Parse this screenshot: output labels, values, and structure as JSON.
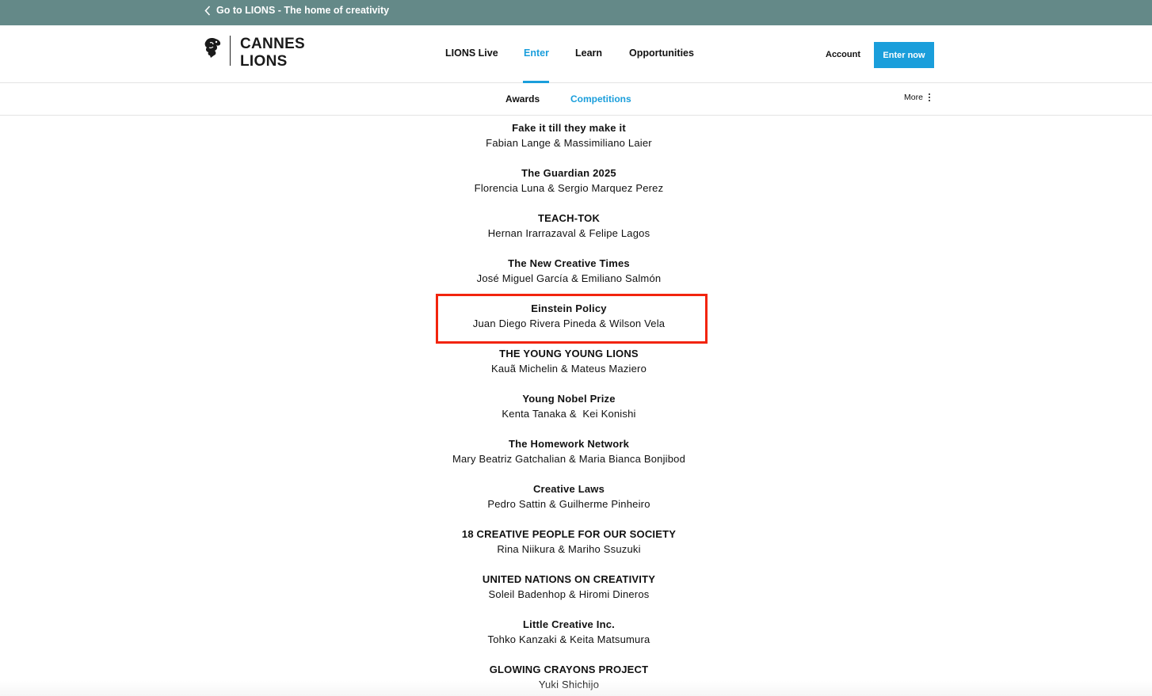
{
  "topbar": {
    "back_link_label": "Go to LIONS - The home of creativity",
    "background_color": "#648988"
  },
  "header": {
    "logo": {
      "line1": "CANNES",
      "line2": "LIONS"
    },
    "nav": [
      {
        "label": "LIONS Live",
        "active": false
      },
      {
        "label": "Enter",
        "active": true
      },
      {
        "label": "Learn",
        "active": false
      },
      {
        "label": "Opportunities",
        "active": false
      }
    ],
    "account_label": "Account",
    "enter_button_label": "Enter now",
    "accent_color": "#1a9edb"
  },
  "subnav": {
    "items": [
      {
        "label": "Awards",
        "active": false
      },
      {
        "label": "Competitions",
        "active": true
      }
    ],
    "more_label": "More"
  },
  "entries": [
    {
      "title": "Fake it till they make it",
      "names": "Fabian Lange & Massimiliano Laier"
    },
    {
      "title": "The Guardian 2025",
      "names": "Florencia Luna & Sergio Marquez Perez"
    },
    {
      "title": "TEACH-TOK",
      "names": "Hernan Irarrazaval & Felipe Lagos"
    },
    {
      "title": "The New Creative Times",
      "names": "José Miguel García & Emiliano Salmón"
    },
    {
      "title": "Einstein Policy",
      "names": "Juan Diego Rivera Pineda & Wilson Vela",
      "highlighted": true
    },
    {
      "title": "THE YOUNG YOUNG LIONS",
      "names": "Kauã Michelin & Mateus Maziero"
    },
    {
      "title": "Young Nobel Prize",
      "names": "Kenta Tanaka &  Kei Konishi"
    },
    {
      "title": "The Homework Network",
      "names": "Mary Beatriz Gatchalian & Maria Bianca Bonjibod"
    },
    {
      "title": "Creative Laws",
      "names": "Pedro Sattin & Guilherme Pinheiro"
    },
    {
      "title": "18 CREATIVE PEOPLE FOR OUR SOCIETY",
      "names": "Rina Niikura & Mariho Ssuzuki"
    },
    {
      "title": "UNITED NATIONS ON CREATIVITY",
      "names": "Soleil Badenhop & Hiromi Dineros"
    },
    {
      "title": "Little Creative Inc.",
      "names": "Tohko Kanzaki & Keita Matsumura"
    },
    {
      "title": "GLOWING CRAYONS PROJECT",
      "names": "Yuki Shichijo"
    }
  ],
  "highlight_color": "#f2240d"
}
